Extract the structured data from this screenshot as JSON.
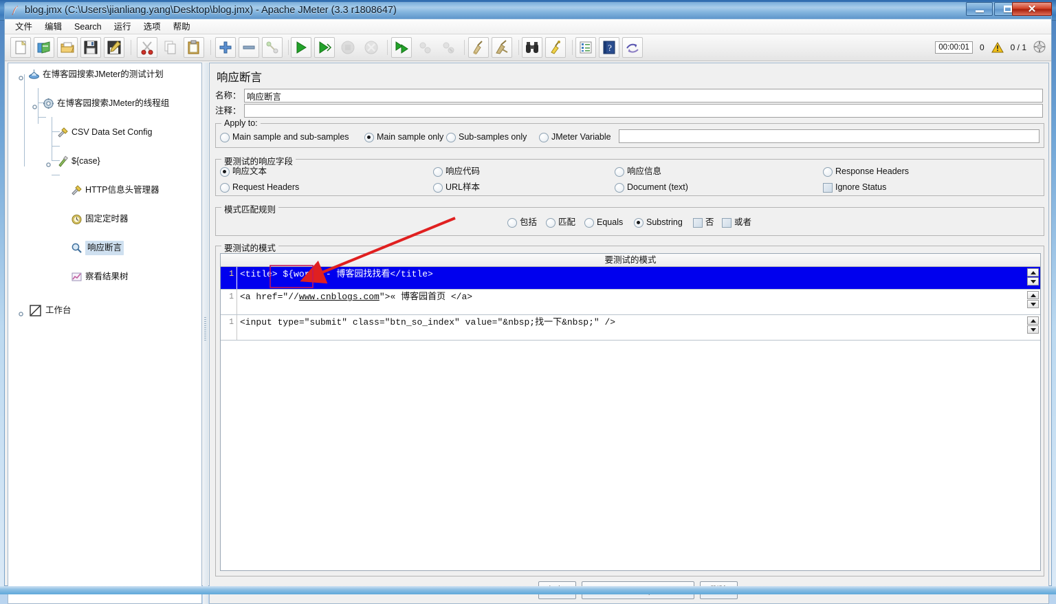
{
  "window": {
    "title": "blog.jmx (C:\\Users\\jianliang.yang\\Desktop\\blog.jmx) - Apache JMeter (3.3 r1808647)",
    "app_icon": "jmeter-feather-icon",
    "minimize_label": "–",
    "maximize_label": "□",
    "close_label": "✕"
  },
  "menubar": {
    "items": [
      {
        "label": "文件"
      },
      {
        "label": "编辑"
      },
      {
        "label": "Search"
      },
      {
        "label": "运行"
      },
      {
        "label": "选项"
      },
      {
        "label": "帮助"
      }
    ]
  },
  "toolbar": {
    "buttons": [
      {
        "name": "new-button",
        "icon": "new-document-icon"
      },
      {
        "name": "templates-button",
        "icon": "templates-icon"
      },
      {
        "name": "open-button",
        "icon": "open-folder-icon"
      },
      {
        "name": "save-button",
        "icon": "save-disk-icon"
      },
      {
        "name": "save-as-button",
        "icon": "save-as-icon"
      },
      {
        "name": "cut-button",
        "icon": "scissors-icon"
      },
      {
        "name": "copy-button",
        "icon": "copy-icon"
      },
      {
        "name": "paste-button",
        "icon": "clipboard-icon"
      },
      {
        "name": "expand-all-button",
        "icon": "plus-icon"
      },
      {
        "name": "collapse-all-button",
        "icon": "minus-icon"
      },
      {
        "name": "toggle-button",
        "icon": "toggle-icon"
      },
      {
        "name": "start-button",
        "icon": "play-icon"
      },
      {
        "name": "start-no-pauses-button",
        "icon": "play-no-pause-icon"
      },
      {
        "name": "stop-button",
        "icon": "stop-icon"
      },
      {
        "name": "shutdown-button",
        "icon": "shutdown-icon"
      },
      {
        "name": "remote-start-all-button",
        "icon": "remote-start-icon"
      },
      {
        "name": "remote-stop-all-button",
        "icon": "remote-stop-icon"
      },
      {
        "name": "remote-shutdown-all-button",
        "icon": "remote-shutdown-icon"
      },
      {
        "name": "clear-button",
        "icon": "broom-clear-icon"
      },
      {
        "name": "clear-all-button",
        "icon": "broom-clear-all-icon"
      },
      {
        "name": "search-button",
        "icon": "binoculars-icon"
      },
      {
        "name": "search-reset-button",
        "icon": "reset-search-icon"
      },
      {
        "name": "function-helper-button",
        "icon": "function-list-icon"
      },
      {
        "name": "help-button",
        "icon": "help-book-icon"
      },
      {
        "name": "undo-button",
        "icon": "undo-arrows-icon"
      }
    ],
    "status": {
      "elapsed": "00:00:01",
      "warning_count": "0",
      "warning_icon": "warning-triangle-icon",
      "threads": "0 / 1",
      "presence_icon": "remote-presence-icon"
    }
  },
  "tree": {
    "nodes": [
      {
        "label": "在博客园搜索JMeter的测试计划",
        "icon": "test-plan-icon",
        "depth": 0,
        "selected": false,
        "expanded": true
      },
      {
        "label": "在博客园搜索JMeter的线程组",
        "icon": "thread-group-icon",
        "depth": 1,
        "selected": false,
        "expanded": true
      },
      {
        "label": "CSV Data Set Config",
        "icon": "config-element-icon",
        "depth": 2,
        "selected": false,
        "expanded": false
      },
      {
        "label": "${case}",
        "icon": "http-sampler-icon",
        "depth": 2,
        "selected": false,
        "expanded": true
      },
      {
        "label": "HTTP信息头管理器",
        "icon": "header-manager-icon",
        "depth": 3,
        "selected": false,
        "expanded": false
      },
      {
        "label": "固定定时器",
        "icon": "timer-icon",
        "depth": 3,
        "selected": false,
        "expanded": false
      },
      {
        "label": "响应断言",
        "icon": "assertion-magnifier-icon",
        "depth": 3,
        "selected": true,
        "expanded": false
      },
      {
        "label": "察看结果树",
        "icon": "view-results-tree-icon",
        "depth": 3,
        "selected": false,
        "expanded": false
      },
      {
        "label": "工作台",
        "icon": "workbench-icon",
        "depth": 0,
        "selected": false,
        "expanded": false
      }
    ]
  },
  "panel": {
    "title": "响应断言",
    "name_label": "名称：",
    "name_value": "响应断言",
    "comment_label": "注释：",
    "comment_value": "",
    "apply_to": {
      "title": "Apply to:",
      "options": [
        {
          "label": "Main sample and sub-samples",
          "selected": false
        },
        {
          "label": "Main sample only",
          "selected": true
        },
        {
          "label": "Sub-samples only",
          "selected": false
        },
        {
          "label": "JMeter Variable",
          "selected": false
        }
      ],
      "variable_value": ""
    },
    "response_field": {
      "title": "要测试的响应字段",
      "options": [
        {
          "label": "响应文本",
          "selected": true,
          "type": "radio"
        },
        {
          "label": "响应代码",
          "selected": false,
          "type": "radio"
        },
        {
          "label": "响应信息",
          "selected": false,
          "type": "radio"
        },
        {
          "label": "Response Headers",
          "selected": false,
          "type": "radio"
        },
        {
          "label": "Request Headers",
          "selected": false,
          "type": "radio"
        },
        {
          "label": "URL样本",
          "selected": false,
          "type": "radio"
        },
        {
          "label": "Document (text)",
          "selected": false,
          "type": "radio"
        },
        {
          "label": "Ignore Status",
          "selected": false,
          "type": "checkbox"
        }
      ]
    },
    "pattern_rules": {
      "title": "模式匹配规则",
      "options": [
        {
          "label": "包括",
          "selected": false,
          "type": "radio"
        },
        {
          "label": "匹配",
          "selected": false,
          "type": "radio"
        },
        {
          "label": "Equals",
          "selected": false,
          "type": "radio"
        },
        {
          "label": "Substring",
          "selected": true,
          "type": "radio"
        },
        {
          "label": "否",
          "selected": false,
          "type": "checkbox"
        },
        {
          "label": "或者",
          "selected": false,
          "type": "checkbox"
        }
      ]
    },
    "patterns": {
      "title": "要测试的模式",
      "column_header": "要测试的模式",
      "rows": [
        {
          "num": "1",
          "text": "<title> ${word} - 博客园找找看</title>",
          "selected": true
        },
        {
          "num": "1",
          "text": "<a href=\"//www.cnblogs.com\">« 博客园首页 </a>",
          "selected": false
        },
        {
          "num": "1",
          "text": "<input type=\"submit\" class=\"btn_so_index\" value=\"&nbsp;找一下&nbsp;\" />",
          "selected": false
        }
      ]
    },
    "buttons": [
      {
        "label": "添加",
        "name": "add-pattern-button"
      },
      {
        "label": "Add from Clipboard",
        "name": "add-from-clipboard-button"
      },
      {
        "label": "删除",
        "name": "delete-pattern-button"
      }
    ]
  },
  "annotation": {
    "highlight_box_target": "${word}",
    "arrow_color": "#e02020",
    "box_color": "#c2185b"
  }
}
